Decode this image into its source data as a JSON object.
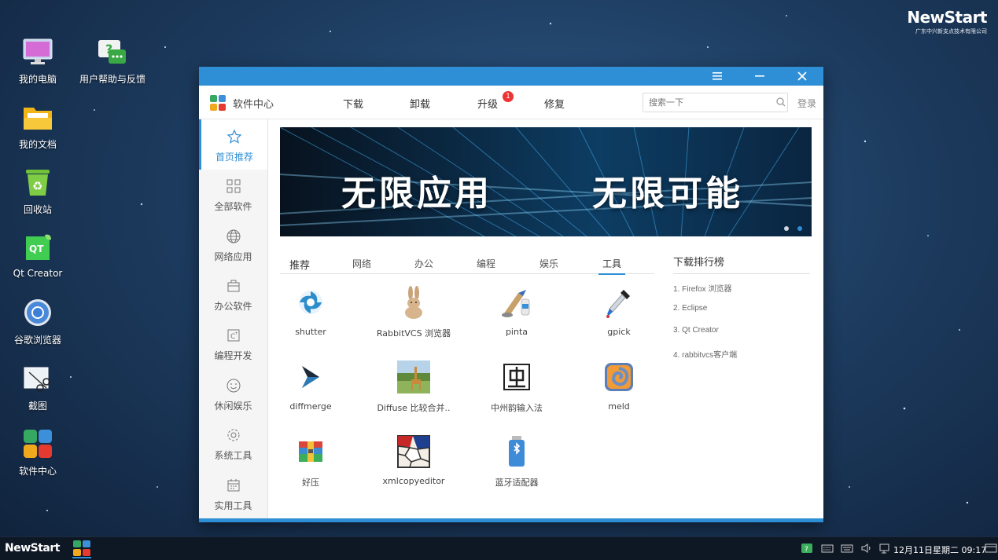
{
  "brand": {
    "name": "NewStart",
    "company": "广东中兴新支点技术有限公司"
  },
  "desktop": {
    "icons": [
      {
        "label": "我的电脑"
      },
      {
        "label": "用户帮助与反馈"
      },
      {
        "label": "我的文档"
      },
      {
        "label": "回收站"
      },
      {
        "label": "Qt Creator"
      },
      {
        "label": "谷歌浏览器"
      },
      {
        "label": "截图"
      },
      {
        "label": "软件中心"
      }
    ]
  },
  "window": {
    "app_name": "软件中心",
    "nav": [
      "下载",
      "卸载",
      "升级",
      "修复"
    ],
    "upgrade_badge": "1",
    "search_placeholder": "搜索一下",
    "login": "登录",
    "sidebar": [
      "首页推荐",
      "全部软件",
      "网络应用",
      "办公软件",
      "编程开发",
      "休闲娱乐",
      "系统工具",
      "实用工具"
    ],
    "banner": {
      "left": "无限应用",
      "right": "无限可能"
    },
    "categories": [
      "推荐",
      "网络",
      "办公",
      "编程",
      "娱乐",
      "工具"
    ],
    "active_category": "工具",
    "apps": [
      "shutter",
      "RabbitVCS 浏览器",
      "pinta",
      "gpick",
      "diffmerge",
      "Diffuse 比较合并..",
      "中州韵输入法",
      "meld",
      "好压",
      "xmlcopyeditor",
      "蓝牙适配器"
    ],
    "rank": {
      "title": "下载排行榜",
      "items": [
        "1. Firefox 浏览器",
        "2. Eclipse",
        "3. Qt Creator",
        "4. rabbitvcs客户端"
      ]
    }
  },
  "taskbar": {
    "start": "NewStart",
    "clock": "12月11日星期二 09:17"
  },
  "colors": {
    "accent": "#2f8fd6",
    "badge": "#e33333"
  }
}
